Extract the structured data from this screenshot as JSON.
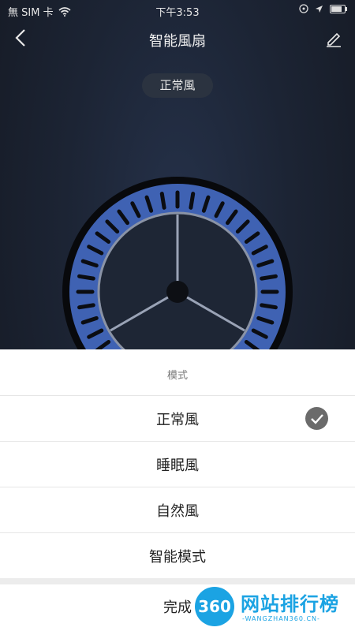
{
  "status_bar": {
    "carrier": "無 SIM 卡",
    "time": "下午3:53"
  },
  "nav": {
    "title": "智能風扇"
  },
  "current_mode": "正常風",
  "sheet": {
    "title": "模式",
    "options": [
      "正常風",
      "睡眠風",
      "自然風",
      "智能模式"
    ],
    "selected_index": 0,
    "done_label": "完成"
  },
  "watermark": {
    "badge": "360",
    "name": "网站排行榜",
    "url": "-WANGZHAN360.CN-"
  },
  "colors": {
    "background": "#1c2434",
    "fan_blue": "#3f62b3",
    "sheet": "#ffffff",
    "check": "#6b6b6b",
    "watermark": "#1ba3e3"
  }
}
